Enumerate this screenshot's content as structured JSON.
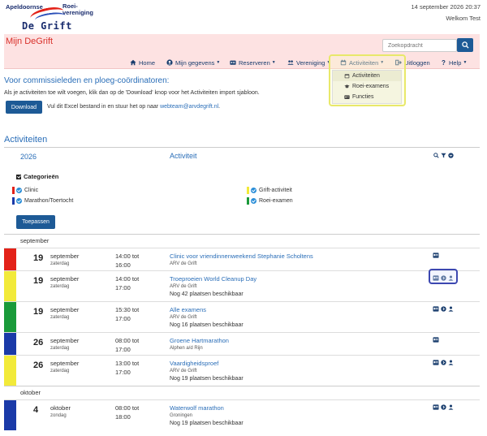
{
  "top": {
    "logo": {
      "line1": "Apeldoornse",
      "line2a": "Roei-",
      "line2b": "vereniging",
      "line3": "De Grift"
    },
    "datetime": "14 september 2026 20:37",
    "welcome": "Welkom Test"
  },
  "header": {
    "title": "Mijn DeGrift",
    "search_placeholder": "Zoekopdracht"
  },
  "nav": {
    "home": "Home",
    "mijn_gegevens": "Mijn gegevens",
    "reserveren": "Reserveren",
    "vereniging": "Vereniging",
    "activiteiten": "Activiteiten",
    "uitloggen": "Uitloggen",
    "help": "Help"
  },
  "dropdown": {
    "items": [
      {
        "label": "Activiteiten",
        "icon": "calendar-icon"
      },
      {
        "label": "Roei-examens",
        "icon": "graduation-cap-icon"
      },
      {
        "label": "Functies",
        "icon": "id-card-icon"
      }
    ]
  },
  "commissie": {
    "title": "Voor commissieleden en ploeg-coördinatoren:",
    "text": "Als je activiteiten toe wilt voegen, klik dan op de 'Download' knop voor het Activiteiten import sjabloon.",
    "download_label": "Download",
    "hint_prefix": "Vul dit Excel bestand in en stuur het op naar ",
    "email": "webteam@arvdegrift.nl",
    "hint_suffix": "."
  },
  "activiteiten": {
    "title": "Activiteiten",
    "year": "2026",
    "column_label": "Activiteit",
    "categories_label": "Categorieën",
    "categories": [
      {
        "label": "Clinic",
        "color": "#e32219"
      },
      {
        "label": "Marathon/Toertocht",
        "color": "#1a3aa8"
      },
      {
        "label": "Grift-activiteit",
        "color": "#f2ea3a"
      },
      {
        "label": "Roei-examen",
        "color": "#1a9a3a"
      }
    ],
    "apply_label": "Toepassen",
    "months": [
      "september",
      "oktober"
    ],
    "rows": [
      {
        "day": "19",
        "month": "september",
        "weekday": "zaterdag",
        "time_from": "14:00 tot",
        "time_to": "16:00",
        "name": "Clinic voor vriendinnenweekend Stephanie Scholtens",
        "location": "ARV de Grift",
        "availability": "",
        "color": "#e32219"
      },
      {
        "day": "19",
        "month": "september",
        "weekday": "zaterdag",
        "time_from": "14:00 tot",
        "time_to": "17:00",
        "name": "Troeproeien World Cleanup Day",
        "location": "ARV de Grift",
        "availability": "Nog 42 plaatsen beschikbaar",
        "color": "#f2ea3a"
      },
      {
        "day": "19",
        "month": "september",
        "weekday": "zaterdag",
        "time_from": "15:30 tot",
        "time_to": "17:00",
        "name": "Alle examens",
        "location": "ARV de Grift",
        "availability": "Nog 16 plaatsen beschikbaar",
        "color": "#1a9a3a"
      },
      {
        "day": "26",
        "month": "september",
        "weekday": "zaterdag",
        "time_from": "08:00 tot",
        "time_to": "17:00",
        "name": "Groene Hartmarathon",
        "location": "Alphen a/d Rijn",
        "availability": "",
        "color": "#1a3aa8"
      },
      {
        "day": "26",
        "month": "september",
        "weekday": "zaterdag",
        "time_from": "13:00 tot",
        "time_to": "17:00",
        "name": "Vaardigheidsproef",
        "location": "ARV de Grift",
        "availability": "Nog 19 plaatsen beschikbaar",
        "color": "#f2ea3a"
      },
      {
        "day": "4",
        "month": "oktober",
        "weekday": "zondag",
        "time_from": "08:00 tot",
        "time_to": "18:00",
        "name": "Waterwolf marathon",
        "location": "Groningen",
        "availability": "Nog 19 plaatsen beschikbaar",
        "color": "#1a3aa8"
      }
    ]
  }
}
